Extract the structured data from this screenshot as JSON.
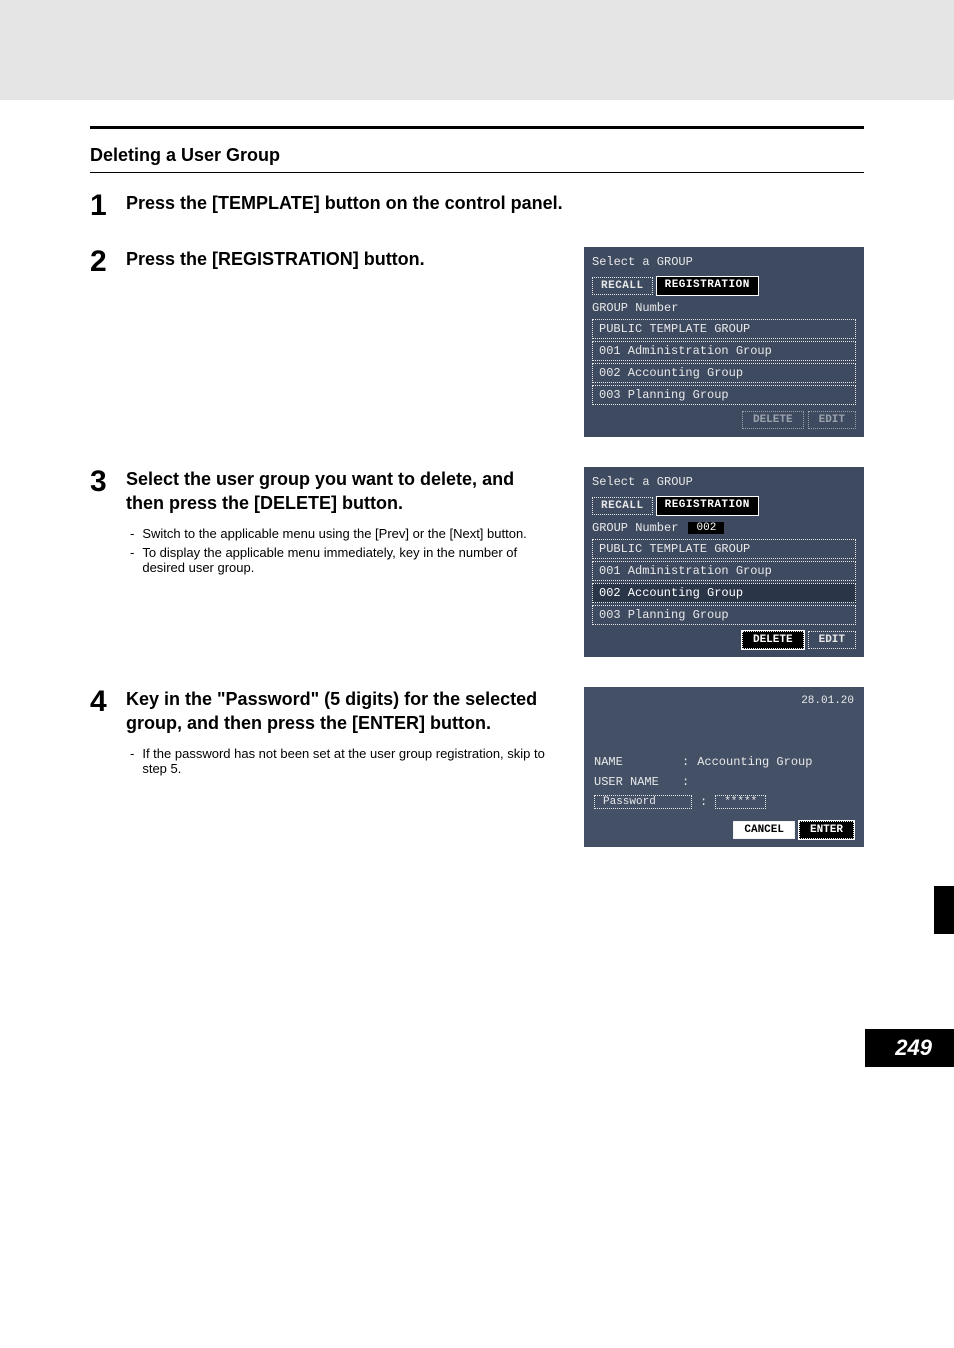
{
  "section_title": "Deleting a User Group",
  "steps": {
    "s1": {
      "num": "1",
      "title": "Press the [TEMPLATE] button on the control panel."
    },
    "s2": {
      "num": "2",
      "title": "Press the [REGISTRATION] button."
    },
    "s3": {
      "num": "3",
      "title": "Select the user group you want to delete, and then press the [DELETE] button.",
      "bullets": {
        "b1": "Switch to the applicable menu using the [Prev] or the [Next] button.",
        "b2": "To display the applicable menu immediately, key in the number of desired user group."
      }
    },
    "s4": {
      "num": "4",
      "title": "Key in the \"Password\" (5 digits) for the selected group, and then press the [ENTER] button.",
      "bullets": {
        "b1": "If the password has not been set at the user group registration, skip to step 5."
      }
    }
  },
  "screen2": {
    "header": "Select a GROUP",
    "tabs": {
      "recall": "RECALL",
      "registration": "REGISTRATION"
    },
    "group_label": "GROUP Number",
    "group_num": "",
    "items": {
      "i0": "PUBLIC TEMPLATE GROUP",
      "i1": "001 Administration Group",
      "i2": "002 Accounting Group",
      "i3": "003 Planning Group"
    },
    "buttons": {
      "delete": "DELETE",
      "edit": "EDIT"
    }
  },
  "screen3": {
    "header": "Select a GROUP",
    "tabs": {
      "recall": "RECALL",
      "registration": "REGISTRATION"
    },
    "group_label": "GROUP Number",
    "group_num": "002",
    "items": {
      "i0": "PUBLIC TEMPLATE GROUP",
      "i1": "001 Administration Group",
      "i2": "002 Accounting Group",
      "i3": "003 Planning Group"
    },
    "buttons": {
      "delete": "DELETE",
      "edit": "EDIT"
    }
  },
  "screen4": {
    "date": "28.01.20",
    "name_label": "NAME",
    "name_value": "Accounting Group",
    "user_label": "USER NAME",
    "user_value": "",
    "pw_label": "Password",
    "pw_value": "*****",
    "buttons": {
      "cancel": "CANCEL",
      "enter": "ENTER"
    }
  },
  "page_number": "249"
}
